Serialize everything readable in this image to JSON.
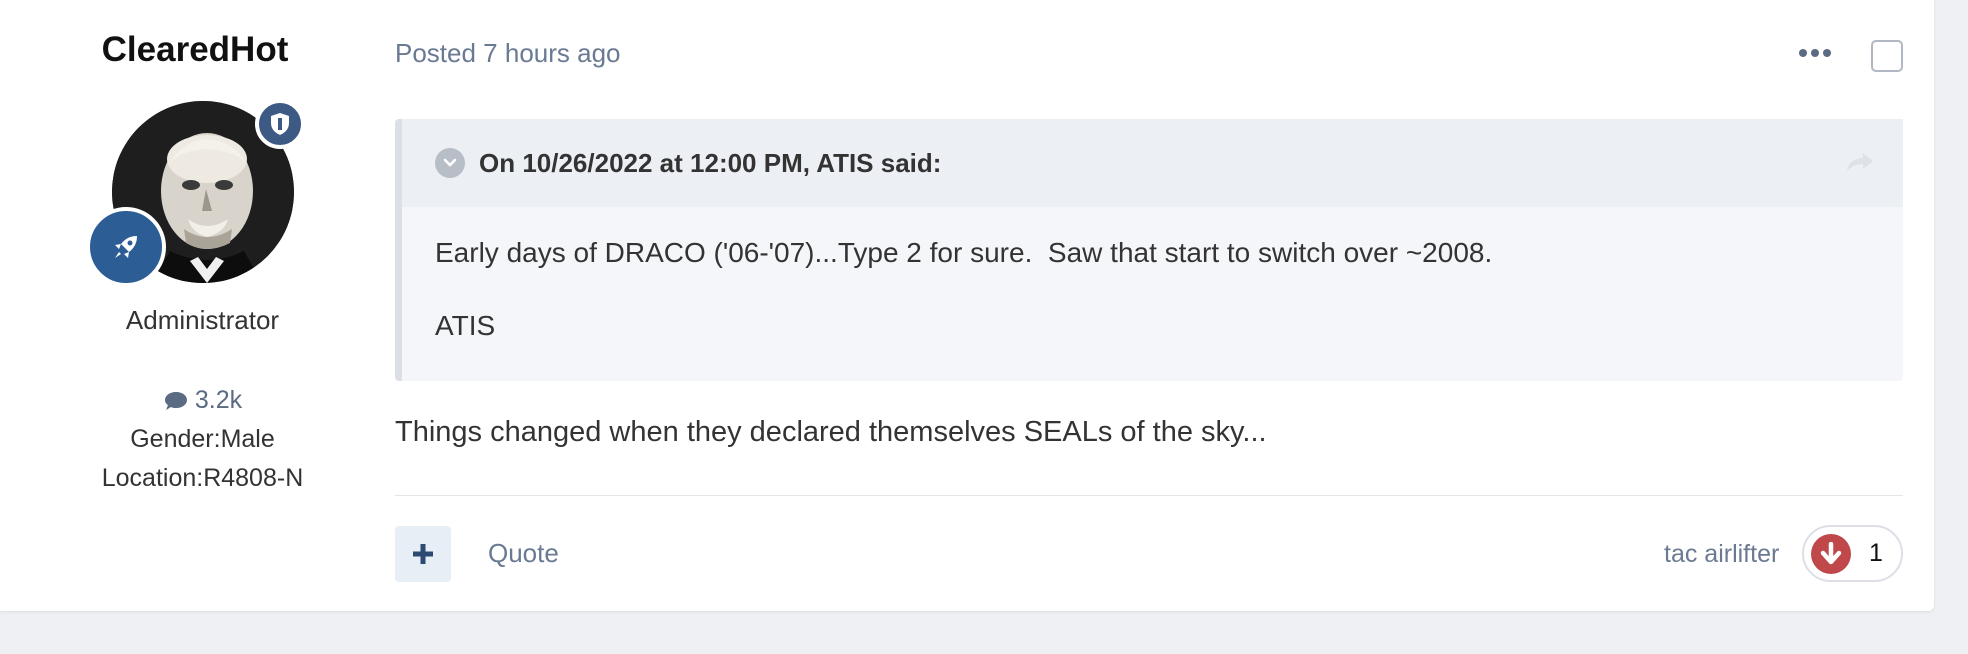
{
  "author": {
    "name": "ClearedHot",
    "role": "Administrator",
    "post_count": "3.2k",
    "gender": "Gender:Male",
    "location": "Location:R4808-N"
  },
  "post": {
    "meta": "Posted 7 hours ago",
    "quote": {
      "citation": "On 10/26/2022 at 12:00 PM, ATIS said:",
      "body": "Early days of DRACO ('06-'07)...Type 2 for sure.  Saw that start to switch over ~2008.",
      "signature": "ATIS"
    },
    "content": "Things changed when they declared themselves SEALs of the sky...",
    "actions": {
      "quote_label": "Quote"
    },
    "reaction": {
      "user": "tac airlifter",
      "count": "1"
    }
  },
  "icons": {
    "menu": "ellipsis-icon",
    "select": "checkbox",
    "toggle": "chevron-down-icon",
    "share": "share-arrow-icon",
    "plus": "plus-icon",
    "reaction": "arrow-down-icon",
    "comment": "comment-icon",
    "shield": "shield-icon",
    "rocket": "rocket-icon"
  },
  "colors": {
    "accent": "#3d5a85",
    "reaction": "#c0474a",
    "muted": "#6a7a92"
  }
}
